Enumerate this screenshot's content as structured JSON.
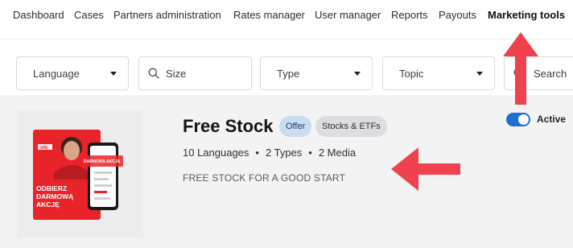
{
  "nav": {
    "items": [
      {
        "label": "Dashboard"
      },
      {
        "label": "Cases"
      },
      {
        "label": "Partners administration"
      },
      {
        "label": "Rates manager"
      },
      {
        "label": "User manager"
      },
      {
        "label": "Reports"
      },
      {
        "label": "Payouts"
      },
      {
        "label": "Marketing tools",
        "active": true
      }
    ]
  },
  "filters": {
    "language": "Language",
    "size": "Size",
    "type": "Type",
    "topic": "Topic",
    "search": "Search"
  },
  "offer": {
    "title": "Free Stock",
    "tags": [
      "Offer",
      "Stocks & ETFs"
    ],
    "languages": "10 Languages",
    "types": "2 Types",
    "media": "2 Media",
    "separator": "•",
    "description": "FREE STOCK FOR A GOOD START",
    "status_label": "Active",
    "status_on": true,
    "thumbnail": {
      "brand": "xtb",
      "headline_lines": [
        "ODBIERZ",
        "DARMOWĄ",
        "AKCJĘ"
      ],
      "phone_badge": "DARMOWA AKCJA"
    }
  },
  "colors": {
    "accent": "#1e6fd0",
    "arrow": "#f0414f",
    "card_bg": "#f3f3f4",
    "thumb_red": "#e8232a"
  }
}
